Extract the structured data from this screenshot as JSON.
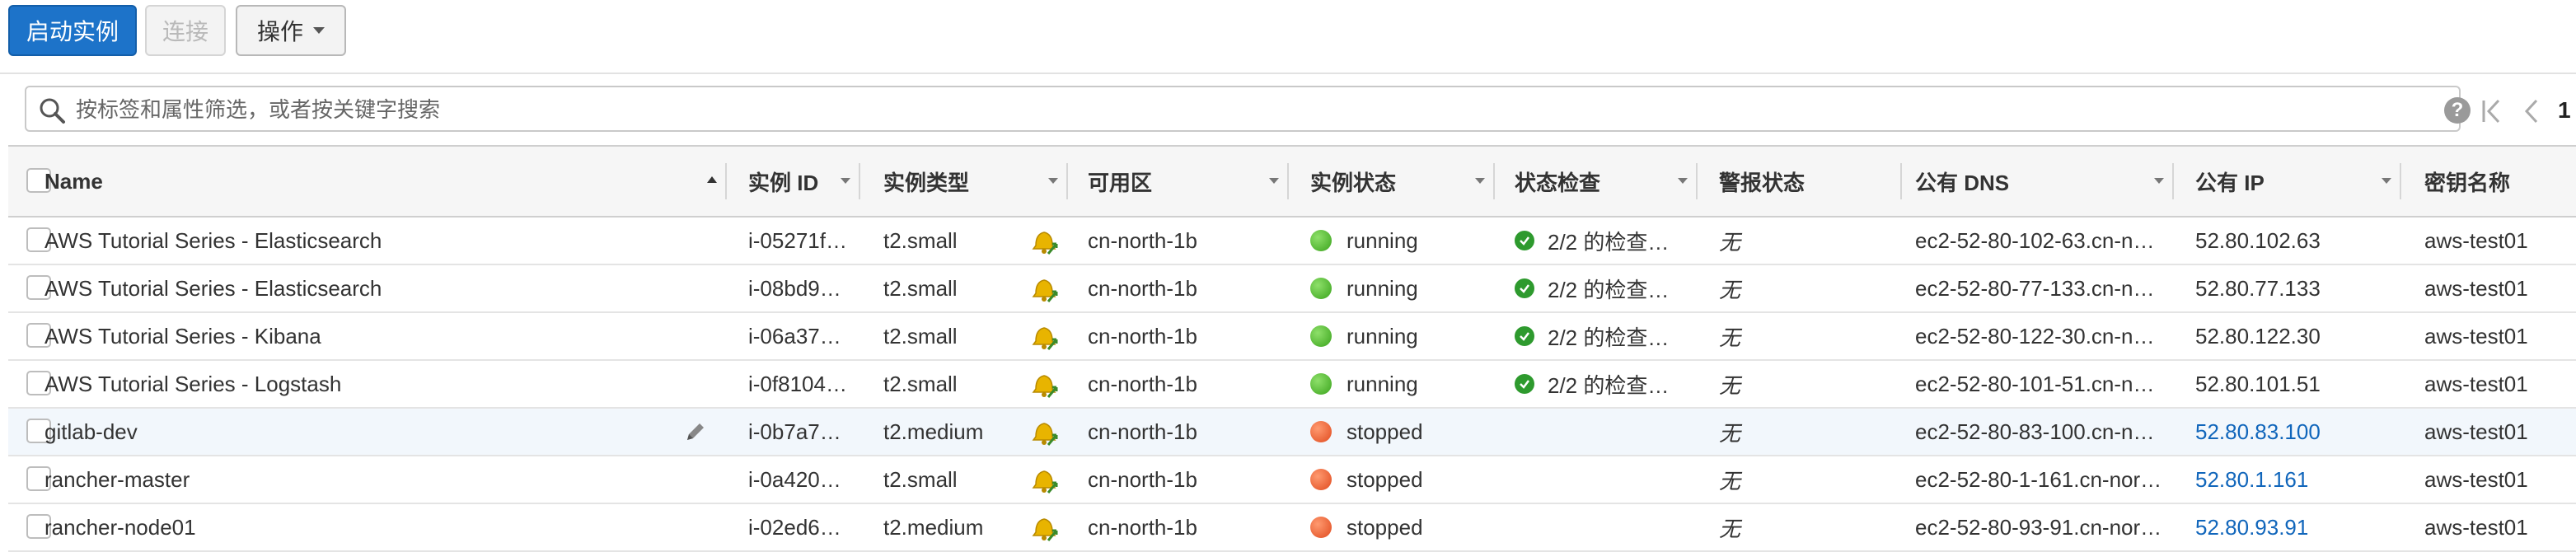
{
  "toolbar": {
    "launch_label": "启动实例",
    "connect_label": "连接",
    "actions_label": "操作"
  },
  "search": {
    "placeholder": "按标签和属性筛选，或者按关键字搜索",
    "page_number": "1"
  },
  "columns": {
    "name": "Name",
    "instance_id": "实例 ID",
    "instance_type": "实例类型",
    "az": "可用区",
    "state": "实例状态",
    "status_check": "状态检查",
    "alarm": "警报状态",
    "public_dns": "公有 DNS",
    "public_ip": "公有 IP",
    "key_name": "密钥名称"
  },
  "rows": [
    {
      "name": "AWS Tutorial Series - Elasticsearch",
      "id": "i-05271f…",
      "type": "t2.small",
      "az": "cn-north-1b",
      "state": "running",
      "state_color": "green",
      "check": "2/2 的检查…",
      "alarm": "无",
      "dns": "ec2-52-80-102-63.cn-n…",
      "ip": "52.80.102.63",
      "ip_link": false,
      "key": "aws-test01"
    },
    {
      "name": "AWS Tutorial Series - Elasticsearch",
      "id": "i-08bd9…",
      "type": "t2.small",
      "az": "cn-north-1b",
      "state": "running",
      "state_color": "green",
      "check": "2/2 的检查…",
      "alarm": "无",
      "dns": "ec2-52-80-77-133.cn-n…",
      "ip": "52.80.77.133",
      "ip_link": false,
      "key": "aws-test01"
    },
    {
      "name": "AWS Tutorial Series - Kibana",
      "id": "i-06a37…",
      "type": "t2.small",
      "az": "cn-north-1b",
      "state": "running",
      "state_color": "green",
      "check": "2/2 的检查…",
      "alarm": "无",
      "dns": "ec2-52-80-122-30.cn-n…",
      "ip": "52.80.122.30",
      "ip_link": false,
      "key": "aws-test01"
    },
    {
      "name": "AWS Tutorial Series - Logstash",
      "id": "i-0f8104…",
      "type": "t2.small",
      "az": "cn-north-1b",
      "state": "running",
      "state_color": "green",
      "check": "2/2 的检查…",
      "alarm": "无",
      "dns": "ec2-52-80-101-51.cn-n…",
      "ip": "52.80.101.51",
      "ip_link": false,
      "key": "aws-test01"
    },
    {
      "name": "gitlab-dev",
      "id": "i-0b7a7…",
      "type": "t2.medium",
      "az": "cn-north-1b",
      "state": "stopped",
      "state_color": "red",
      "check": "",
      "alarm": "无",
      "dns": "ec2-52-80-83-100.cn-n…",
      "ip": "52.80.83.100",
      "ip_link": true,
      "key": "aws-test01"
    },
    {
      "name": "rancher-master",
      "id": "i-0a420…",
      "type": "t2.small",
      "az": "cn-north-1b",
      "state": "stopped",
      "state_color": "red",
      "check": "",
      "alarm": "无",
      "dns": "ec2-52-80-1-161.cn-nor…",
      "ip": "52.80.1.161",
      "ip_link": true,
      "key": "aws-test01"
    },
    {
      "name": "rancher-node01",
      "id": "i-02ed6…",
      "type": "t2.medium",
      "az": "cn-north-1b",
      "state": "stopped",
      "state_color": "red",
      "check": "",
      "alarm": "无",
      "dns": "ec2-52-80-93-91.cn-nor…",
      "ip": "52.80.93.91",
      "ip_link": true,
      "key": "aws-test01"
    }
  ]
}
